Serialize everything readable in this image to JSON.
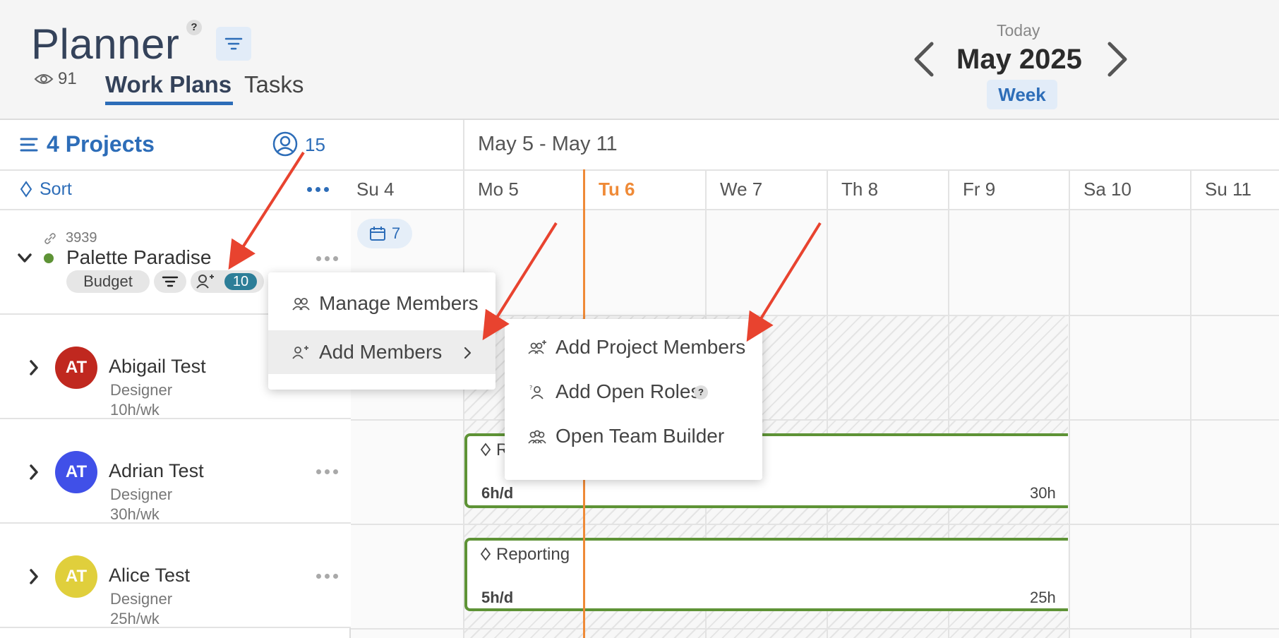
{
  "header": {
    "title": "Planner",
    "help": "?",
    "views_count": "91",
    "tabs": [
      {
        "label": "Work Plans"
      },
      {
        "label": "Tasks"
      }
    ],
    "today_label": "Today",
    "month_label": "May 2025",
    "view_mode": "Week"
  },
  "sidebar": {
    "projects_label": "4 Projects",
    "member_count": "15",
    "sort_label": "Sort",
    "project": {
      "id": "3939",
      "name": "Palette Paradise",
      "status_color": "#5e9336",
      "budget_label": "Budget",
      "members_badge": "10"
    },
    "members": [
      {
        "initials": "AT",
        "name": "Abigail Test",
        "role": "Designer",
        "hours": "10h/wk",
        "color": "#c0281f"
      },
      {
        "initials": "AT",
        "name": "Adrian Test",
        "role": "Designer",
        "hours": "30h/wk",
        "color": "#4050e8"
      },
      {
        "initials": "AT",
        "name": "Alice Test",
        "role": "Designer",
        "hours": "25h/wk",
        "color": "#e0cf3c"
      }
    ]
  },
  "calendar": {
    "week_range": "May 5 - May 11",
    "days": [
      "Su 4",
      "Mo 5",
      "Tu 6",
      "We 7",
      "Th 8",
      "Fr 9",
      "Sa 10",
      "Su 11"
    ],
    "today_day": "Tu 6",
    "chip_count": "7",
    "bars": [
      {
        "label": "R",
        "rate": "6h/d",
        "total": "30h"
      },
      {
        "label": "Reporting",
        "rate": "5h/d",
        "total": "25h"
      }
    ]
  },
  "context_menu": {
    "items": [
      {
        "label": "Manage Members"
      },
      {
        "label": "Add Members"
      }
    ]
  },
  "submenu": {
    "items": [
      {
        "label": "Add Project Members"
      },
      {
        "label": "Add Open Roles"
      },
      {
        "label": "Open Team Builder"
      }
    ],
    "help": "?"
  },
  "colors": {
    "accent": "#2d6db8",
    "today": "#ef8a37",
    "project_green": "#5e9336",
    "annotation_arrow": "#e8432f"
  }
}
